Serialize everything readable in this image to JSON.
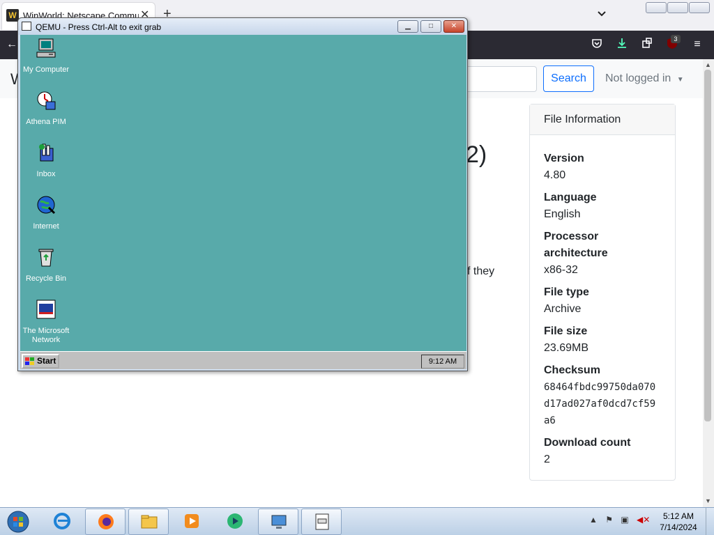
{
  "browser": {
    "tab_title": "WinWorld: Netscape Communicator",
    "tab_favicon_letter": "W",
    "toolbar_badge": "3"
  },
  "page": {
    "logo_fragment": "W",
    "search_button": "Search",
    "login_status": "Not logged in",
    "heading_fragment": "2)",
    "text_fragment": "f they",
    "file_info": {
      "title": "File Information",
      "items": [
        {
          "label": "Version",
          "value": "4.80"
        },
        {
          "label": "Language",
          "value": "English"
        },
        {
          "label": "Processor architecture",
          "value": "x86-32"
        },
        {
          "label": "File type",
          "value": "Archive"
        },
        {
          "label": "File size",
          "value": "23.69MB"
        },
        {
          "label": "Checksum",
          "value": "68464fbdc99750da070d17ad027af0dcd7cf59a6"
        },
        {
          "label": "Download count",
          "value": "2"
        }
      ]
    }
  },
  "qemu": {
    "title": "QEMU - Press Ctrl-Alt to exit grab",
    "desktop_icons": [
      {
        "label": "My Computer",
        "icon": "my-computer-icon"
      },
      {
        "label": "Athena PIM",
        "icon": "athena-pim-icon"
      },
      {
        "label": "Inbox",
        "icon": "inbox-icon"
      },
      {
        "label": "Internet",
        "icon": "internet-icon"
      },
      {
        "label": "Recycle Bin",
        "icon": "recycle-bin-icon"
      },
      {
        "label": "The Microsoft Network",
        "icon": "msn-icon"
      }
    ],
    "start_label": "Start",
    "tray_time": "9:12 AM"
  },
  "win7": {
    "clock_time": "5:12 AM",
    "clock_date": "7/14/2024",
    "pinned": [
      "internet-explorer-icon",
      "firefox-icon",
      "file-explorer-icon",
      "media-player-icon",
      "app-icon",
      "remote-desktop-icon",
      "qemu-icon"
    ]
  },
  "colors": {
    "win95_desktop": "#58aaaa",
    "browser_toolbar": "#2b2a33",
    "accent": "#0d6efd"
  }
}
